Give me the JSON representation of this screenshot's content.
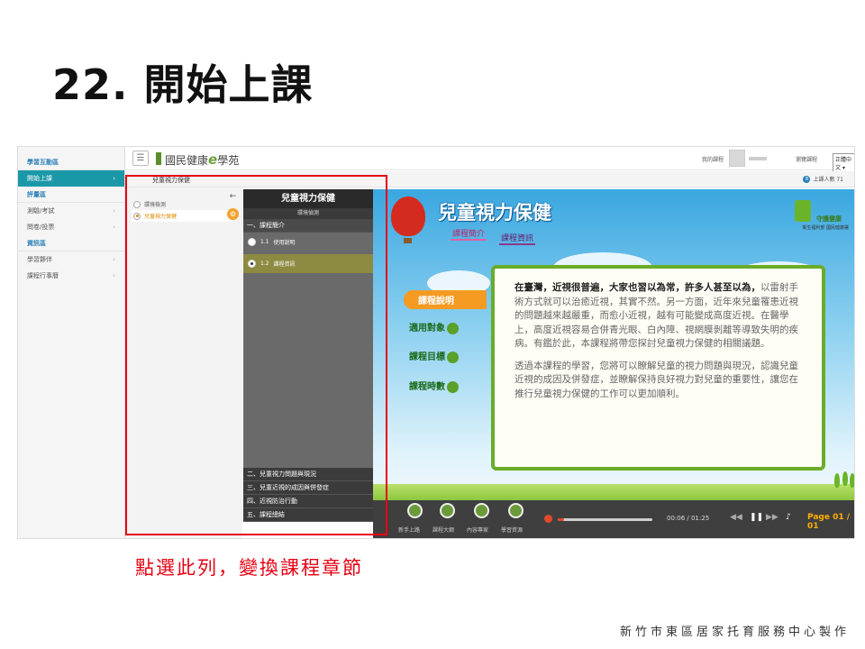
{
  "slide": {
    "title": "22. 開始上課",
    "caption": "點選此列，變換課程章節",
    "footer": "新竹市東區居家托育服務中心製作"
  },
  "app": {
    "logo_text": "國民健康",
    "logo_e": "e",
    "logo_suffix": "學苑",
    "menu_icon": "☰",
    "top_links": {
      "my_courses": "我的課程",
      "my_notes": "瀏覽課程",
      "language": "正體中文"
    },
    "online_count": "上課人數 71",
    "online_icon": "8"
  },
  "sidebar": {
    "groups": [
      {
        "title": "學習互動區",
        "items": [
          {
            "label": "開始上課",
            "active": true
          }
        ]
      },
      {
        "title": "評量區",
        "items": [
          {
            "label": "測驗/考試",
            "active": false
          },
          {
            "label": "問卷/投票",
            "active": false
          }
        ]
      },
      {
        "title": "資訊區",
        "items": [
          {
            "label": "學習夥伴",
            "active": false
          },
          {
            "label": "課程行事曆",
            "active": false
          }
        ]
      }
    ]
  },
  "breadcrumb": "兒童視力保健",
  "env_panel": {
    "items": [
      {
        "label": "環境檢測",
        "selected": false
      },
      {
        "label": "兒童視力保健",
        "selected": true
      }
    ],
    "back_icon": "←",
    "gear_icon": "⚙"
  },
  "chapter_menu": {
    "title": "兒童視力保健",
    "subtitle": "環境偵測",
    "chapters": [
      {
        "label": "一、課程簡介"
      },
      {
        "label": "二、兒童視力問題與現況"
      },
      {
        "label": "三、兒童近視的成因與併發症"
      },
      {
        "label": "四、近視防治行動"
      },
      {
        "label": "五、課程總結"
      }
    ],
    "lessons": [
      {
        "num": "1.1",
        "label": "使用說明",
        "selected": false
      },
      {
        "num": "1.2",
        "label": "課程資訊",
        "selected": true
      }
    ]
  },
  "course": {
    "title": "兒童視力保健",
    "tabs": [
      "課程簡介",
      "課程資訊"
    ],
    "brand_name": "守護健康",
    "brand_org": "衛生福利部 國民健康署",
    "sections": [
      "課程說明",
      "適用對象",
      "課程目標",
      "課程時數"
    ],
    "paragraph1_lead": "在臺灣，近視很普遍，大家也習以為常，許多人甚至以為，",
    "paragraph1_rest": "以雷射手術方式就可以治癒近視，其實不然。另一方面，近年來兒童罹患近視的問題越來越嚴重，而愈小近視，越有可能變成高度近視。在醫學上，高度近視容易合併青光眼、白內障、視網膜剝離等導致失明的疾病。有鑑於此，本課程將帶您探討兒童視力保健的相關議題。",
    "paragraph2": "透過本課程的學習，您將可以瞭解兒童的視力問題與現況，認識兒童近視的成因及併發症，並瞭解保持良好視力對兒童的重要性，讓您在推行兒童視力保健的工作可以更加順利。"
  },
  "player": {
    "buttons": [
      "新手上路",
      "課程大綱",
      "內容專家",
      "學習資源"
    ],
    "time": "00:06 / 01:25",
    "page_label": "Page",
    "page_value": "01 / 01",
    "progress": 0.07
  }
}
